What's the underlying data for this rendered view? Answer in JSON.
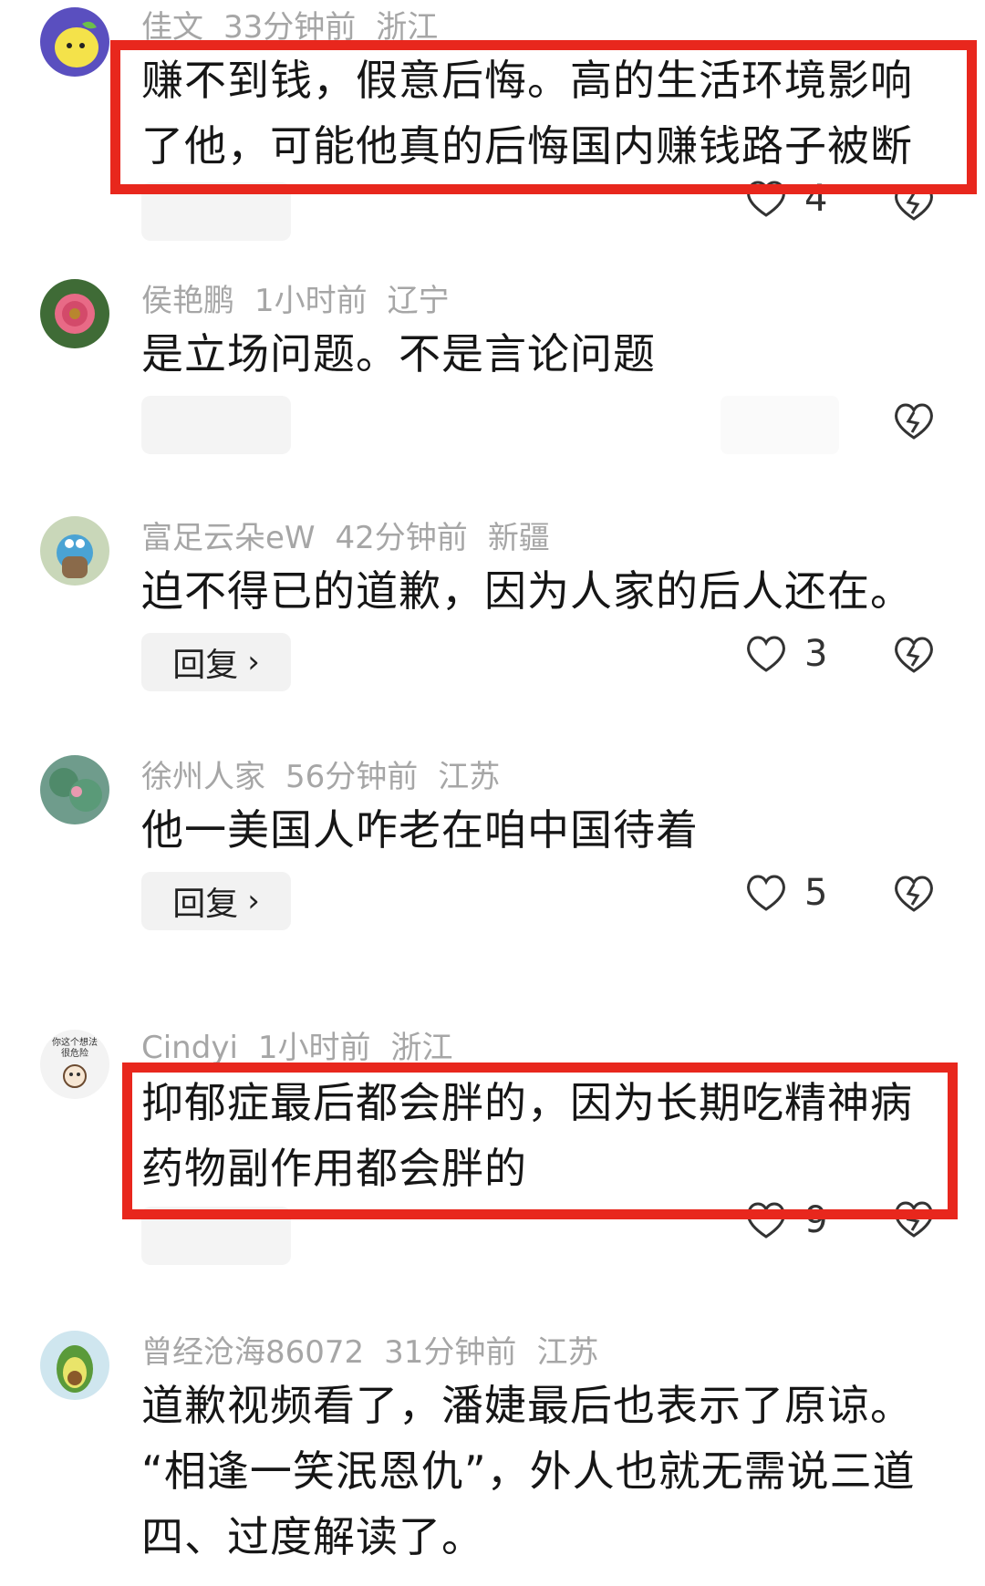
{
  "comments": [
    {
      "user": "佳文",
      "time": "33分钟前",
      "location": "浙江",
      "avatar": "lemon-avatar",
      "text": [
        "赚不到钱，假意后悔。高的生活环境影响",
        "了他，可能他真的后悔国内赚钱路子被断"
      ],
      "likes": "4",
      "highlighted": true
    },
    {
      "user": "侯艳鹏",
      "time": "1小时前",
      "location": "辽宁",
      "avatar": "flower-avatar",
      "text": [
        "是立场问题。不是言论问题"
      ],
      "likes": "",
      "highlighted": false
    },
    {
      "user": "富足云朵eW",
      "time": "42分钟前",
      "location": "新疆",
      "avatar": "cartoon-avatar",
      "text": [
        "迫不得已的道歉，因为人家的后人还在。"
      ],
      "likes": "3",
      "reply": "回复",
      "highlighted": false
    },
    {
      "user": "徐州人家",
      "time": "56分钟前",
      "location": "江苏",
      "avatar": "lotus-avatar",
      "text": [
        "他一美国人咋老在咱中国待着"
      ],
      "likes": "5",
      "reply": "回复",
      "highlighted": false
    },
    {
      "user": "Cindyi",
      "time": "1小时前",
      "location": "浙江",
      "avatar": "dog-sticker-avatar",
      "avatar_text": "你这个想法 很危险",
      "text": [
        "抑郁症最后都会胖的，因为长期吃精神病",
        "药物副作用都会胖的"
      ],
      "likes": "9",
      "highlighted": true
    },
    {
      "user": "曾经沧海86072",
      "time": "31分钟前",
      "location": "江苏",
      "avatar": "avocado-avatar",
      "text": [
        "道歉视频看了，潘婕最后也表示了原谅。",
        "“相逢一笑泯恩仇”，外人也就无需说三道",
        "四、过度解读了。"
      ],
      "likes": "",
      "highlighted": false
    }
  ],
  "colors": {
    "highlight": "#e8271d",
    "meta": "#a6a6a6",
    "text": "#161616"
  }
}
